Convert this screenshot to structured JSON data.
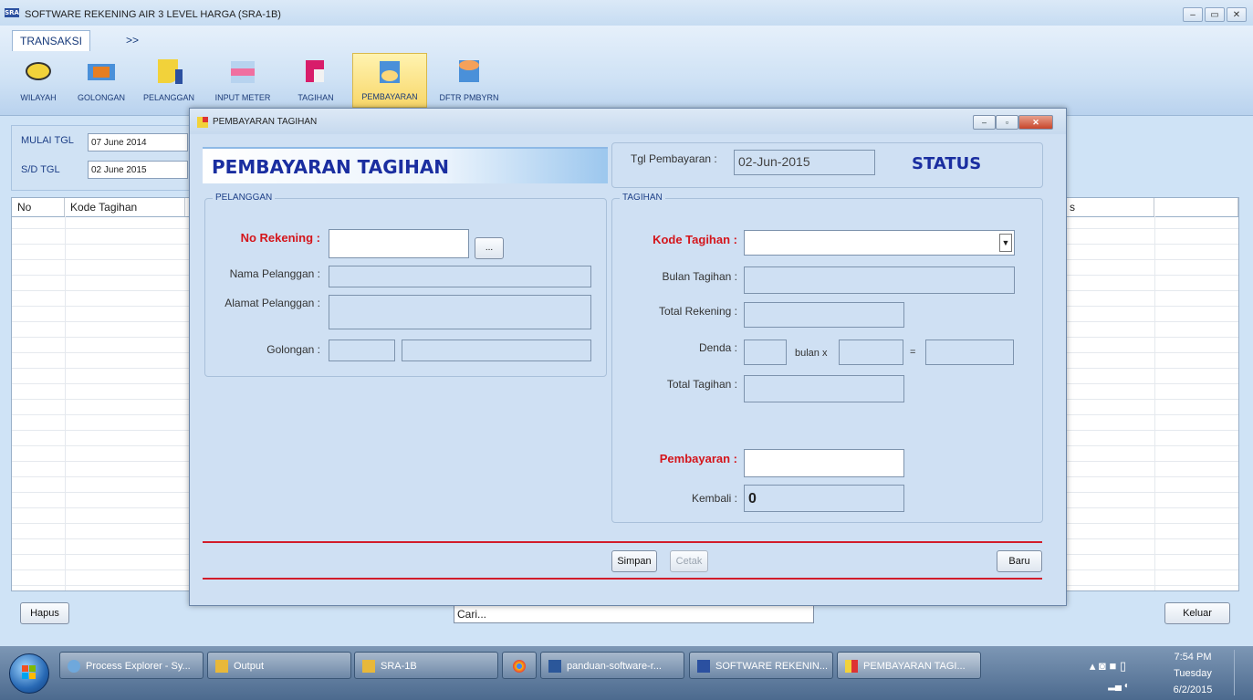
{
  "window": {
    "title": "SOFTWARE REKENING AIR 3 LEVEL HARGA (SRA-1B)",
    "icon_text": "SRA"
  },
  "ribbon": {
    "tabs": [
      {
        "label": "TRANSAKSI"
      },
      {
        "label": ">>"
      }
    ],
    "buttons": [
      {
        "label": "WILAYAH",
        "icon": "region-icon"
      },
      {
        "label": "GOLONGAN",
        "icon": "category-icon"
      },
      {
        "label": "PELANGGAN",
        "icon": "customer-icon"
      },
      {
        "label": "INPUT METER",
        "icon": "meter-icon"
      },
      {
        "label": "TAGIHAN",
        "icon": "bill-icon"
      },
      {
        "label": "PEMBAYARAN",
        "icon": "payment-icon"
      },
      {
        "label": "DFTR PMBYRN",
        "icon": "payment-list-icon"
      }
    ]
  },
  "filter": {
    "start_label": "MULAI TGL",
    "start_value": "07 June 2014",
    "end_label": "S/D TGL",
    "end_value": "02 June 2015"
  },
  "grid": {
    "columns": [
      "No",
      "Kode Tagihan",
      "s",
      ""
    ]
  },
  "bottom": {
    "delete_label": "Hapus",
    "search_value": "Cari...",
    "exit_label": "Keluar"
  },
  "dialog": {
    "title": "PEMBAYARAN TAGIHAN",
    "banner": "PEMBAYARAN TAGIHAN",
    "date_label": "Tgl Pembayaran :",
    "date_value": "02-Jun-2015",
    "status": "STATUS",
    "pelanggan": {
      "group": "PELANGGAN",
      "no_rekening_label": "No Rekening :",
      "browse_label": "...",
      "nama_label": "Nama Pelanggan :",
      "alamat_label": "Alamat Pelanggan :",
      "golongan_label": "Golongan :"
    },
    "tagihan": {
      "group": "TAGIHAN",
      "kode_label": "Kode Tagihan :",
      "bulan_label": "Bulan Tagihan :",
      "total_rekening_label": "Total Rekening :",
      "denda_label": "Denda :",
      "bulan_x": "bulan x",
      "equals": "=",
      "total_tagihan_label": "Total Tagihan :",
      "pembayaran_label": "Pembayaran :",
      "kembali_label": "Kembali :",
      "kembali_value": "0"
    },
    "buttons": {
      "simpan": "Simpan",
      "cetak": "Cetak",
      "baru": "Baru"
    }
  },
  "taskbar": {
    "items": [
      {
        "label": "Process Explorer - Sy..."
      },
      {
        "label": "Output"
      },
      {
        "label": "SRA-1B"
      },
      {
        "label": "panduan-software-r..."
      },
      {
        "label": "SOFTWARE REKENIN..."
      },
      {
        "label": "PEMBAYARAN TAGI..."
      }
    ],
    "time": "7:54 PM",
    "day": "Tuesday",
    "date": "6/2/2015"
  }
}
